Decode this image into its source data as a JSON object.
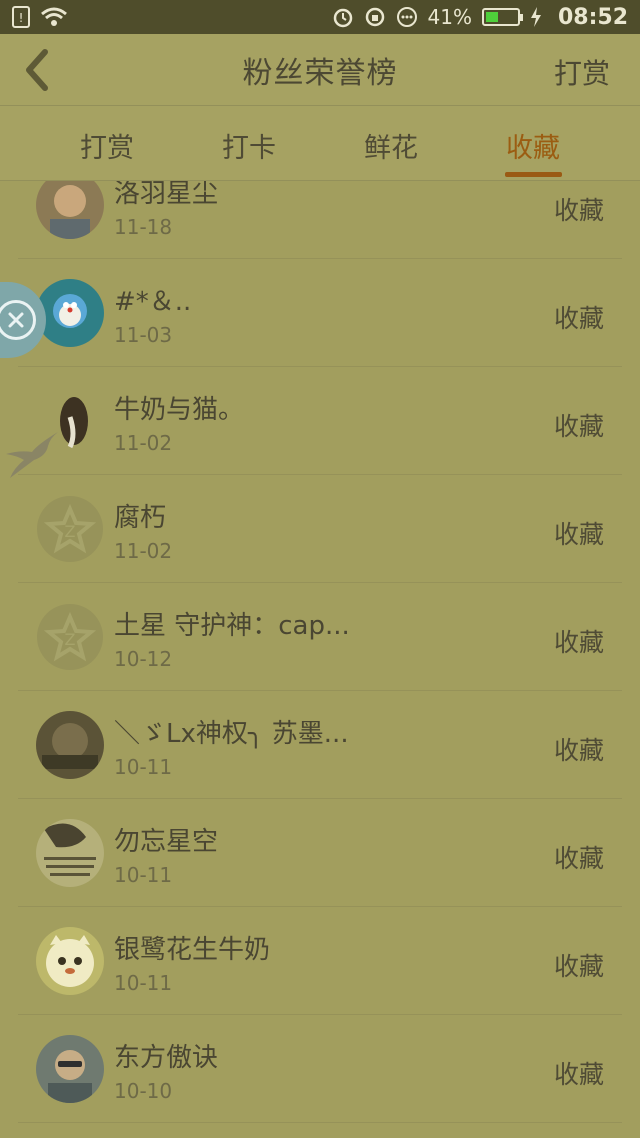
{
  "status_bar": {
    "battery_percent": "41%",
    "time": "08:52",
    "battery_level": 0.41,
    "icons": [
      "sim-icon",
      "wifi-icon",
      "alarm-icon",
      "rotation-lock-icon",
      "dots-icon",
      "battery-icon",
      "charging-icon"
    ]
  },
  "header": {
    "title": "粉丝荣誉榜",
    "action": "打赏",
    "back_icon": "chevron-left-icon"
  },
  "tabs": [
    {
      "label": "打赏"
    },
    {
      "label": "打卡"
    },
    {
      "label": "鲜花"
    },
    {
      "label": "收藏",
      "active": true
    }
  ],
  "list": [
    {
      "name": "洛羽星尘",
      "date": "11-18",
      "action": "收藏"
    },
    {
      "name": "#*＆..",
      "date": "11-03",
      "action": "收藏"
    },
    {
      "name": "牛奶与猫。",
      "date": "11-02",
      "action": "收藏"
    },
    {
      "name": "腐朽",
      "date": "11-02",
      "action": "收藏"
    },
    {
      "name": "土星 守护神：cap...",
      "date": "10-12",
      "action": "收藏"
    },
    {
      "name": "＼ゞLx神权╮ 苏墨...",
      "date": "10-11",
      "action": "收藏"
    },
    {
      "name": "勿忘星空",
      "date": "10-11",
      "action": "收藏"
    },
    {
      "name": "银鹭花生牛奶",
      "date": "10-11",
      "action": "收藏"
    },
    {
      "name": "东方傲诀",
      "date": "10-10",
      "action": "收藏"
    }
  ],
  "colors": {
    "background": "#a29e5e",
    "active_tab": "#9b5d12",
    "status_bar": "#4f4d2b"
  }
}
